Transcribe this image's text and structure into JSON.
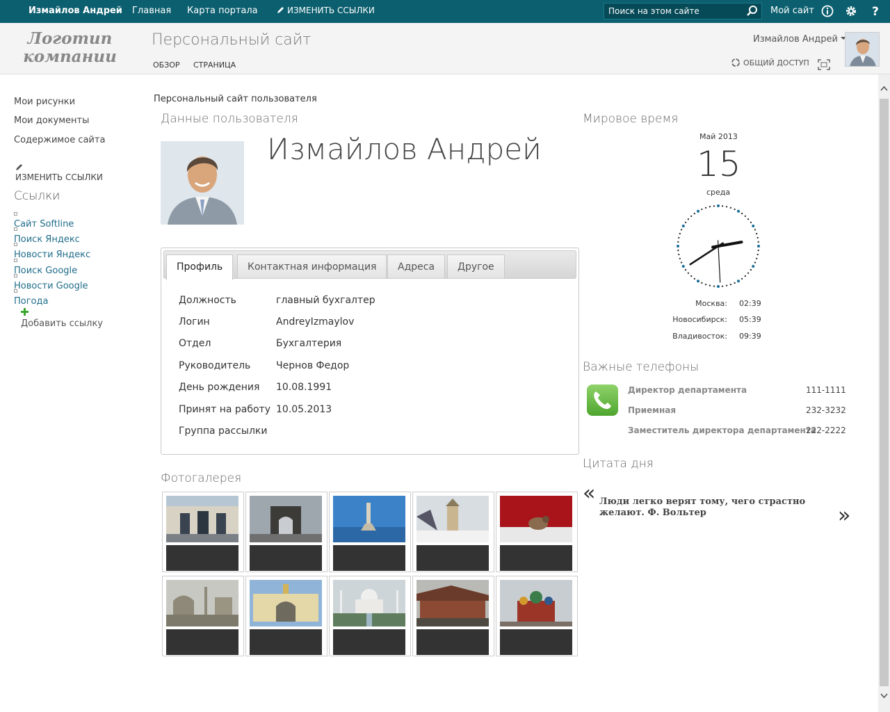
{
  "topbar": {
    "user": "Измайлов Андрей",
    "nav": [
      "Главная",
      "Карта портала"
    ],
    "edit_links": "ИЗМЕНИТЬ ССЫЛКИ",
    "search_placeholder": "Поиск на этом сайте",
    "my_site": "Мой сайт",
    "icons": [
      "info-icon",
      "gear-icon",
      "help-icon"
    ],
    "color": "#0b5f6f"
  },
  "header": {
    "logo_line1": "Логотип",
    "logo_line2": "компании",
    "site_title": "Персональный сайт",
    "subnav": [
      "ОБЗОР",
      "СТРАНИЦА"
    ],
    "user_menu": "Измайлов Андрей",
    "share": "ОБЩИЙ ДОСТУП"
  },
  "leftnav": {
    "items": [
      "Мои рисунки",
      "Мои документы",
      "Содержимое сайта"
    ],
    "edit_links": "ИЗМЕНИТЬ ССЫЛКИ",
    "links_heading": "Ссылки",
    "links": [
      "Сайт Softline",
      "Поиск Яндекс",
      "Новости Яндекс",
      "Поиск Google",
      "Новости Google",
      "Погода"
    ],
    "add_link": "Добавить ссылку"
  },
  "main": {
    "breadcrumb": "Персональный сайт пользователя",
    "user_data_title": "Данные пользователя",
    "full_name": "Измайлов Андрей",
    "tabs": [
      "Профиль",
      "Контактная информация",
      "Адреса",
      "Другое"
    ],
    "profile": [
      {
        "label": "Должность",
        "value": "главный бухгалтер"
      },
      {
        "label": "Логин",
        "value": "AndreyIzmaylov"
      },
      {
        "label": "Отдел",
        "value": "Бухгалтерия"
      },
      {
        "label": "Руководитель",
        "value": "Чернов Федор"
      },
      {
        "label": "День рождения",
        "value": "10.08.1991"
      },
      {
        "label": "Принят на работу",
        "value": "10.05.2013"
      },
      {
        "label": "Группа рассылки",
        "value": ""
      }
    ],
    "gallery_title": "Фотогалерея"
  },
  "world_time": {
    "title": "Мировое время",
    "month": "Май 2013",
    "day": "15",
    "weekday": "среда",
    "cities": [
      {
        "city": "Москва:",
        "time": "02:39"
      },
      {
        "city": "Новосибирск:",
        "time": "05:39"
      },
      {
        "city": "Владивосток:",
        "time": "09:39"
      }
    ]
  },
  "phones": {
    "title": "Важные телефоны",
    "items": [
      {
        "name": "Директор департамента",
        "number": "111-1111"
      },
      {
        "name": "Приемная",
        "number": "232-3232"
      },
      {
        "name": "Заместитель директора департамента",
        "number": "222-2222"
      }
    ]
  },
  "quote": {
    "title": "Цитата дня",
    "text": "Люди легко верят тому, чего страстно желают. Ф. Вольтер",
    "prev": "«",
    "next": "»"
  }
}
